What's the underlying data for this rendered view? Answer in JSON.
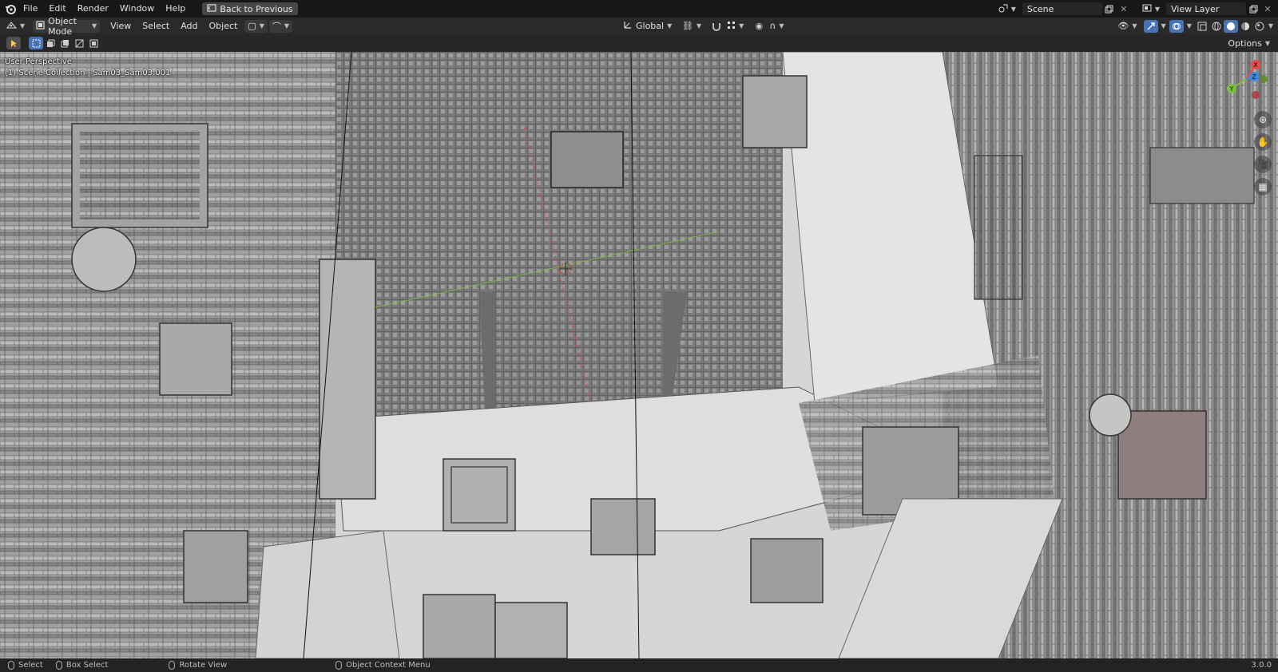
{
  "topbar": {
    "menu": [
      "File",
      "Edit",
      "Render",
      "Window",
      "Help"
    ],
    "back_button": "Back to Previous",
    "scene_name": "Scene",
    "view_layer_name": "View Layer"
  },
  "header": {
    "mode": "Object Mode",
    "menus": [
      "View",
      "Select",
      "Add",
      "Object"
    ],
    "transform_orientation": "Global"
  },
  "toolrow": {
    "options_label": "Options"
  },
  "viewport": {
    "view_name": "User Perspective",
    "collection_path": "(1) Scene Collection | Sam03_Sam03.001",
    "gizmo": {
      "x": "X",
      "y": "Y",
      "z": "Z"
    }
  },
  "statusbar": {
    "items": [
      "Select",
      "Box Select",
      "Rotate View",
      "Object Context Menu"
    ],
    "version": "3.0.0"
  },
  "colors": {
    "axis_x": "#e94a4a",
    "axis_y": "#7fbf3a",
    "axis_z": "#3a8de0",
    "accent": "#4772b3"
  }
}
